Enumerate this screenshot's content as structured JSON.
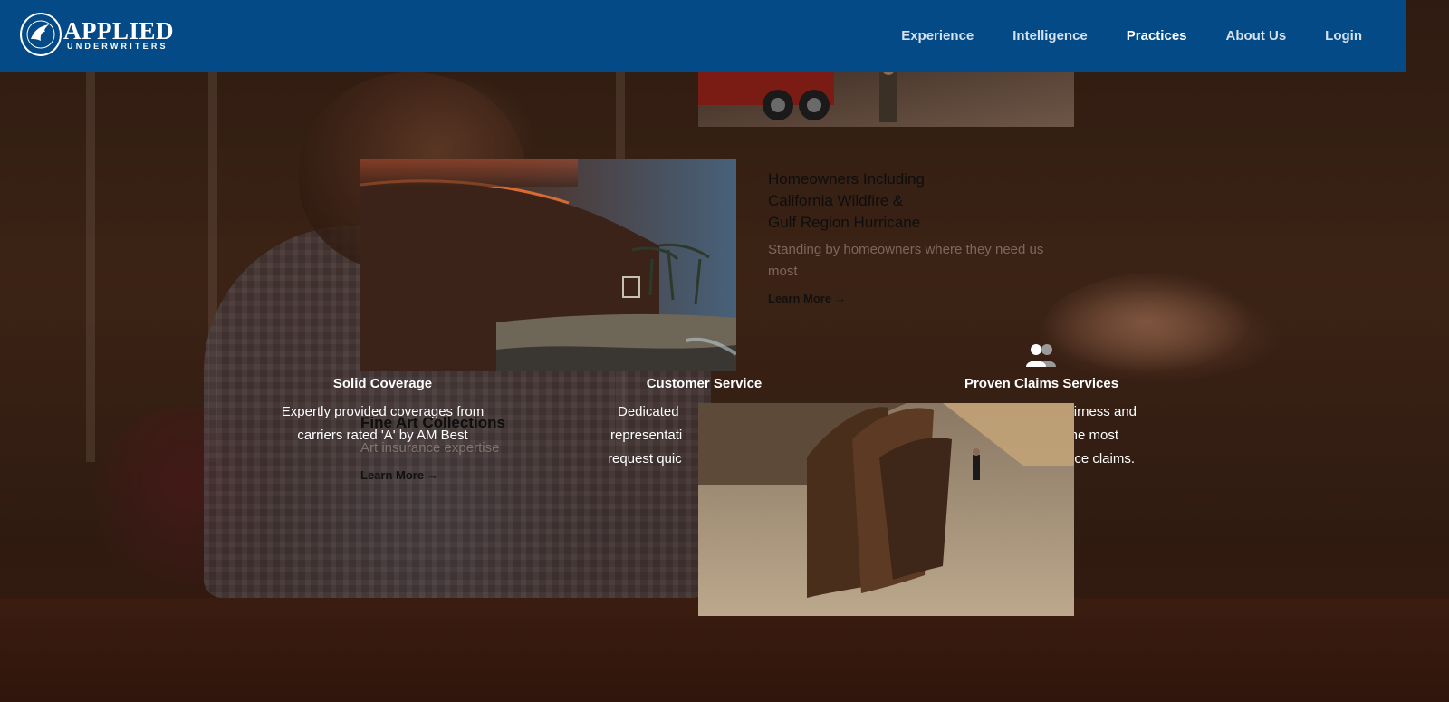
{
  "brand": {
    "name_top": "APPLIED",
    "name_bottom": "UNDERWRITERS",
    "primary_color": "#034a87"
  },
  "nav": {
    "items": [
      {
        "label": "Experience",
        "active": false
      },
      {
        "label": "Intelligence",
        "active": false
      },
      {
        "label": "Practices",
        "active": true
      },
      {
        "label": "About Us",
        "active": false
      },
      {
        "label": "Login",
        "active": false
      }
    ]
  },
  "features": [
    {
      "icon": "shield-icon",
      "title": "Solid Coverage",
      "lines": [
        "Expertly provided coverages from",
        "carriers rated 'A' by AM Best"
      ]
    },
    {
      "icon": "headset-icon",
      "title": "Customer Service",
      "lines": [
        "Dedicated",
        "representati",
        "request quic"
      ]
    },
    {
      "icon": "people-icon",
      "title": "Proven Claims Services",
      "lines": [
        "fairness and",
        "n the most",
        "ce claims."
      ]
    }
  ],
  "cards": {
    "homeowners": {
      "title_lines": [
        "Homeowners Including",
        "California Wildfire &",
        "Gulf Region Hurricane"
      ],
      "description": "Standing by homeowners where they need us most",
      "learn_more": "Learn More"
    },
    "fine_art": {
      "title": "Fine Art Collections",
      "description": "Art insurance expertise",
      "learn_more": "Learn More"
    }
  }
}
